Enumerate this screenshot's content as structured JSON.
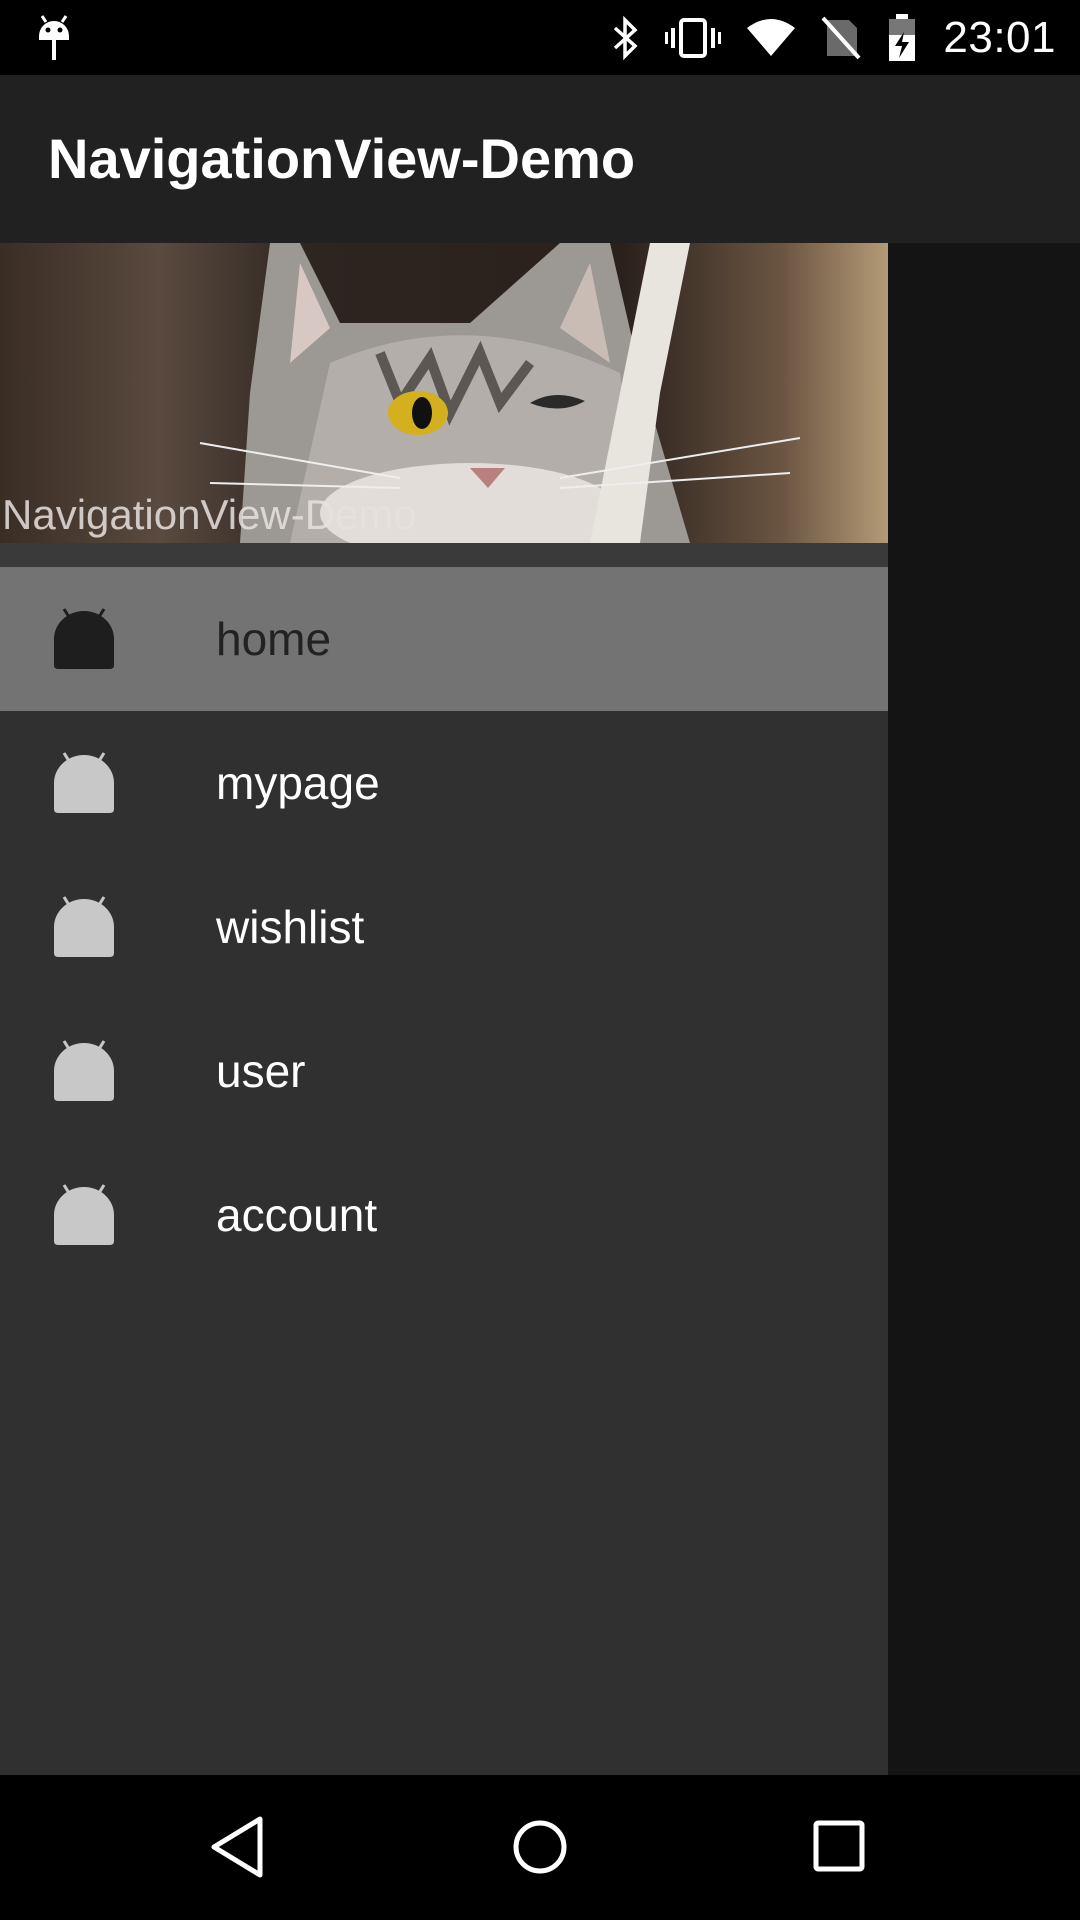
{
  "status_bar": {
    "time": "23:01",
    "left_icon": "android-debug-icon",
    "right_icons": [
      "bluetooth-icon",
      "vibrate-icon",
      "wifi-icon",
      "no-sim-icon",
      "battery-charging-icon"
    ]
  },
  "app_bar": {
    "title": "NavigationView-Demo"
  },
  "drawer": {
    "header_title": "NavigationView-Demo",
    "header_image": "cat-photo",
    "items": [
      {
        "label": "home",
        "icon": "android-icon",
        "selected": true
      },
      {
        "label": "mypage",
        "icon": "android-icon",
        "selected": false
      },
      {
        "label": "wishlist",
        "icon": "android-icon",
        "selected": false
      },
      {
        "label": "user",
        "icon": "android-icon",
        "selected": false
      },
      {
        "label": "account",
        "icon": "android-icon",
        "selected": false
      }
    ]
  },
  "nav_bar": {
    "buttons": [
      "back-icon",
      "home-icon",
      "recents-icon"
    ]
  },
  "colors": {
    "app_bar": "#212121",
    "drawer": "#303030",
    "selected_item": "#737373",
    "scrim": "#141414"
  }
}
